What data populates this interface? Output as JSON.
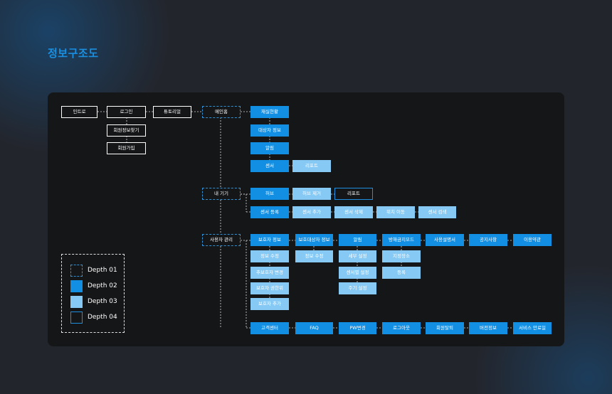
{
  "page_title": "정보구조도",
  "colors": {
    "background": "#23252c",
    "panel": "#151618",
    "depth2": "#128fe3",
    "depth3": "#86c9f4",
    "outline_blue": "#1f8ee0",
    "title": "#1a8fe0"
  },
  "depth1": {
    "intro": "인트로",
    "login": "로그인",
    "find_info": "회원정보찾기",
    "signup": "회원가입",
    "tutorial": "튜토리얼",
    "main_home": "메인홈",
    "my_devices": "내 기기",
    "user_manage": "사용자 관리"
  },
  "main_home": {
    "meal_status": "재실현황",
    "target_info": "대상자 정보",
    "alarm": "알림",
    "sensor": "센서",
    "report": "리포트"
  },
  "devices": {
    "hub": "허브",
    "hub_remove": "허브 제거",
    "report": "리포트",
    "sensor_register": "센서 등록",
    "sensor_add": "센서 추가",
    "sensor_delete": "센서 삭제",
    "location_move": "위치 이동",
    "sensor_search": "센서 검색"
  },
  "user": {
    "guardian_info": "보호자 정보",
    "protected_info": "보호대상자 정보",
    "alarm": "알림",
    "security_mode": "방해금지모드",
    "manual": "사용설명서",
    "notice": "공지사항",
    "terms": "이용약관",
    "info_edit_1": "정보 수정",
    "add_guardian_edit": "추보호자 변경",
    "guardian_permission": "보호자 권한위",
    "guardian_add": "보호자 추가",
    "info_edit_2": "정보 수정",
    "detail_setting": "세부 설정",
    "sensor_setting": "센서별 설정",
    "cycle_setting": "주기 설정",
    "designated_place": "지정장소",
    "register": "등록",
    "support": "고객센터",
    "faq": "FAQ",
    "pw_change": "PW변경",
    "logout": "로그아웃",
    "withdraw": "회원탈퇴",
    "version": "버전정보",
    "service_end": "서비스 만료일"
  },
  "legend": [
    {
      "label": "Depth 01"
    },
    {
      "label": "Depth 02"
    },
    {
      "label": "Depth 03"
    },
    {
      "label": "Depth 04"
    }
  ]
}
